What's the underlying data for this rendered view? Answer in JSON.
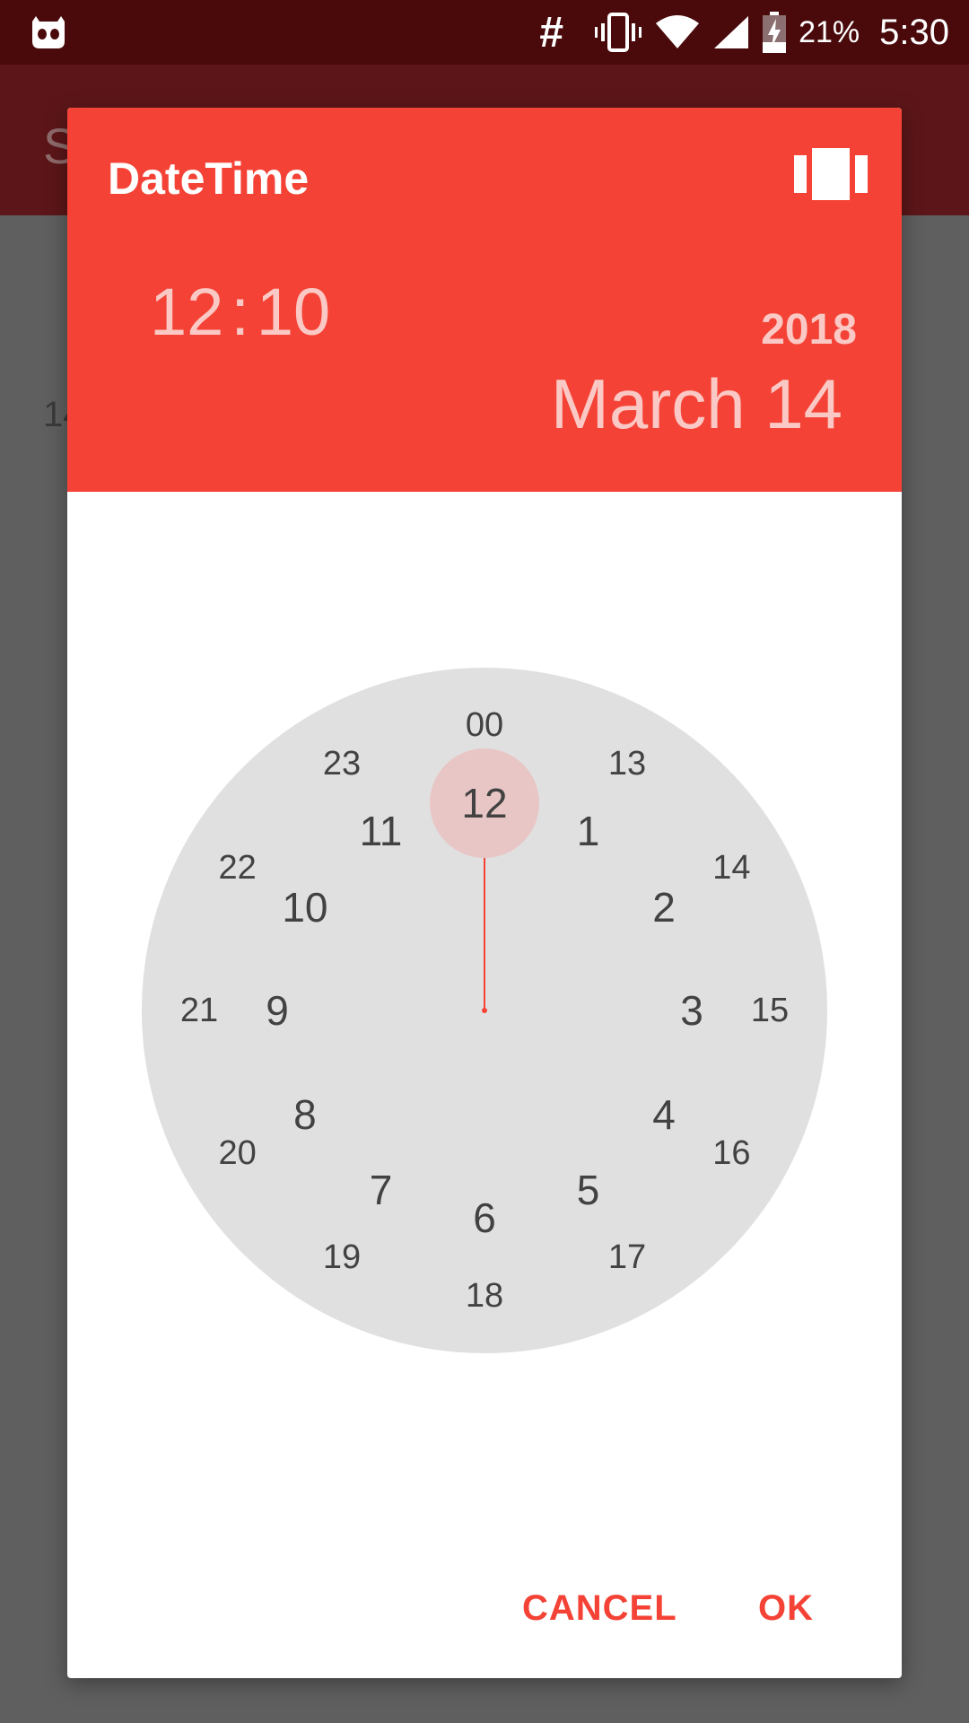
{
  "status_bar": {
    "app_icon": "cyanogen-bot-icon",
    "hash_label": "#",
    "icons": [
      "vibrate-icon",
      "wifi-icon",
      "signal-icon",
      "battery-charging-icon"
    ],
    "battery_percent": "21%",
    "time": "5:30"
  },
  "background_app": {
    "title_fragment": "S",
    "content_fragment": "14"
  },
  "dialog": {
    "title": "DateTime",
    "switch_icon": "view-carousel-icon",
    "time": {
      "hour": "12",
      "separator": ":",
      "minute": "10"
    },
    "year": "2018",
    "date": "March 14",
    "clock": {
      "selected": "12",
      "outer_numbers": [
        "12",
        "1",
        "2",
        "3",
        "4",
        "5",
        "6",
        "7",
        "8",
        "9",
        "10",
        "11"
      ],
      "inner_numbers": [
        "00",
        "13",
        "14",
        "15",
        "16",
        "17",
        "18",
        "19",
        "20",
        "21",
        "22",
        "23"
      ]
    },
    "actions": {
      "cancel": "CANCEL",
      "ok": "OK"
    }
  },
  "colors": {
    "accent": "#f44336",
    "header_text_dim": "#fbc9c5",
    "clock_face": "#e0e0e0",
    "selection": "#e8c6c5"
  }
}
